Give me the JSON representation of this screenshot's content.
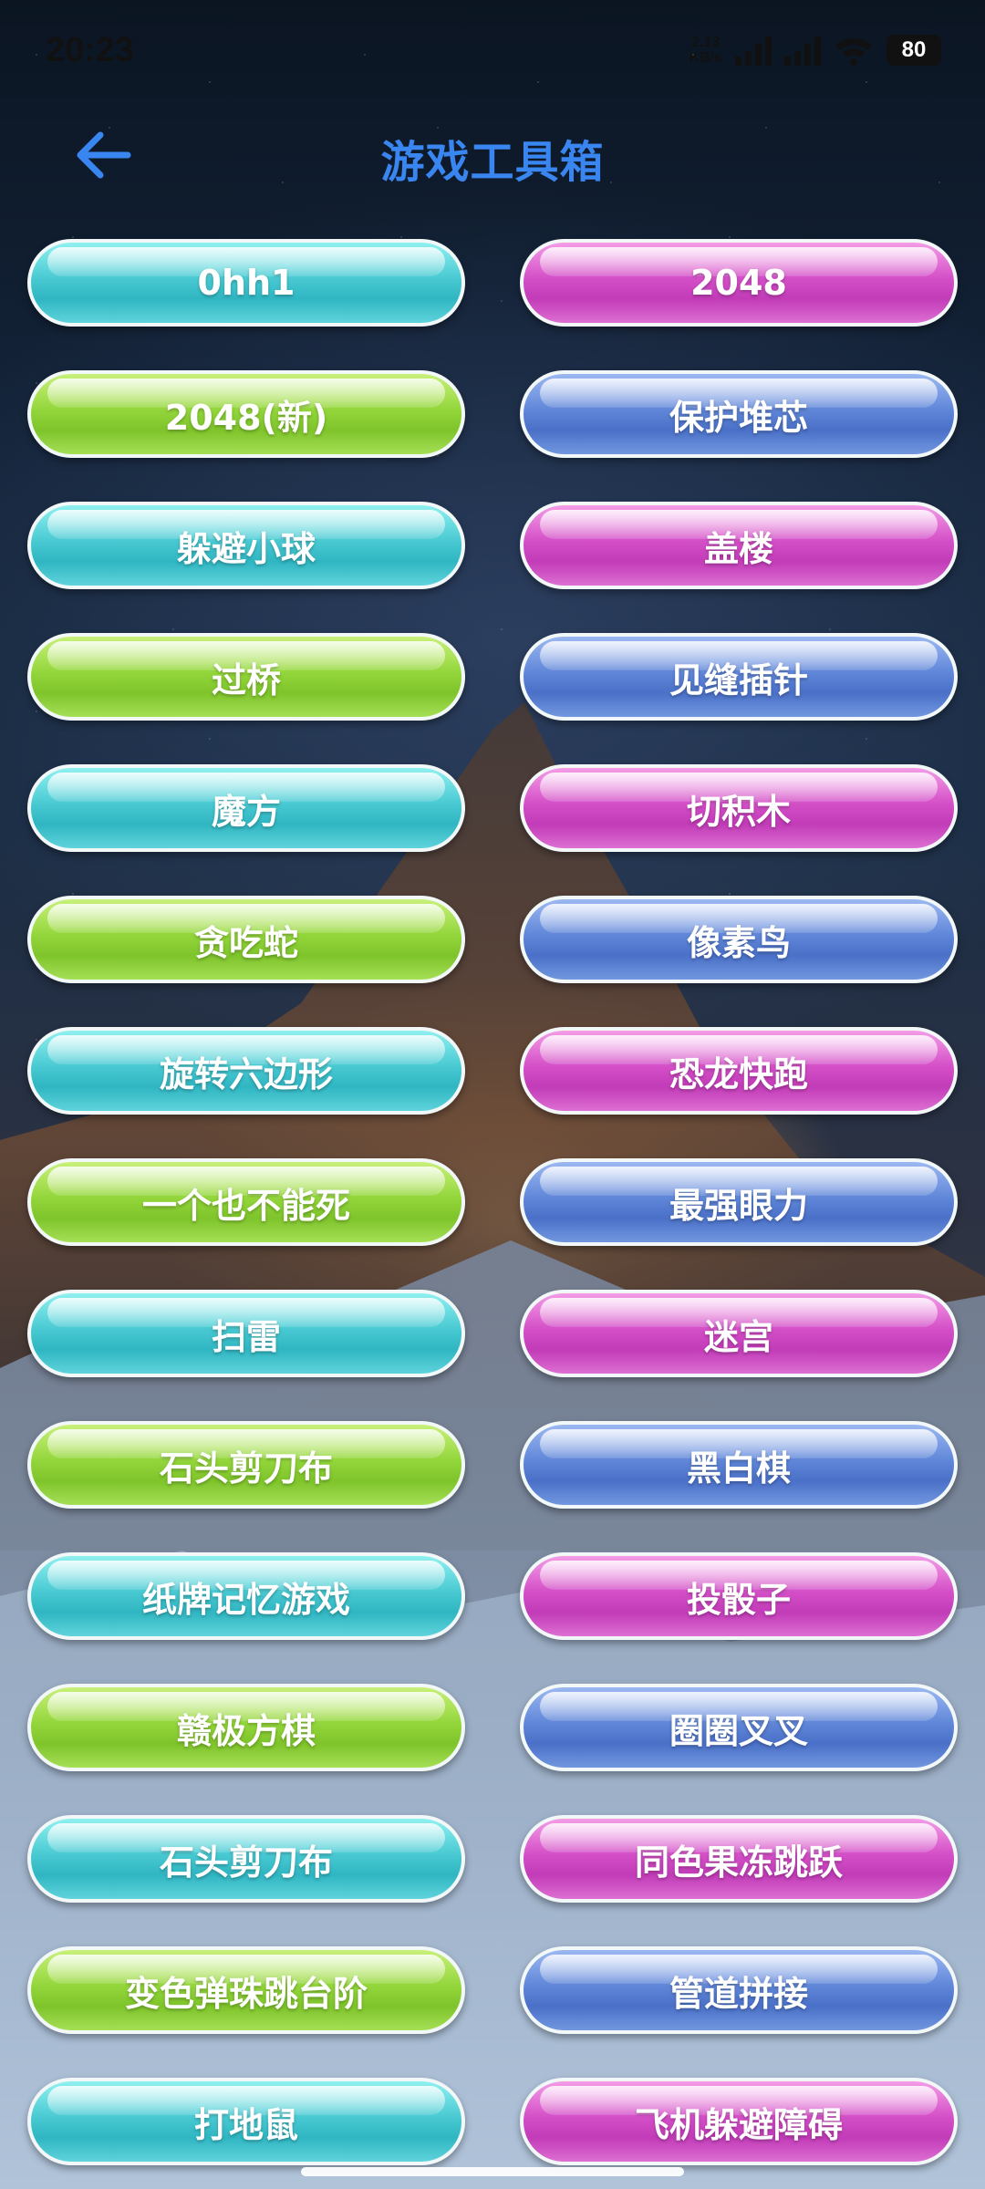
{
  "status": {
    "time": "20:23",
    "net_speed_value": "2.13",
    "net_speed_unit": "KB/s",
    "battery": "80"
  },
  "header": {
    "title": "游戏工具箱",
    "back_icon": "arrow-left-icon"
  },
  "colors": {
    "title": "#3a86f0",
    "cyan": "#48c9d2",
    "green": "#93d63b",
    "magenta": "#d34fc7",
    "blue": "#5f86d8"
  },
  "games": [
    {
      "label": "0hh1",
      "color": "cyan"
    },
    {
      "label": "2048",
      "color": "magenta"
    },
    {
      "label": "2048(新)",
      "color": "green"
    },
    {
      "label": "保护堆芯",
      "color": "blue"
    },
    {
      "label": "躲避小球",
      "color": "cyan"
    },
    {
      "label": "盖楼",
      "color": "magenta"
    },
    {
      "label": "过桥",
      "color": "green"
    },
    {
      "label": "见缝插针",
      "color": "blue"
    },
    {
      "label": "魔方",
      "color": "cyan"
    },
    {
      "label": "切积木",
      "color": "magenta"
    },
    {
      "label": "贪吃蛇",
      "color": "green"
    },
    {
      "label": "像素鸟",
      "color": "blue"
    },
    {
      "label": "旋转六边形",
      "color": "cyan"
    },
    {
      "label": "恐龙快跑",
      "color": "magenta"
    },
    {
      "label": "一个也不能死",
      "color": "green"
    },
    {
      "label": "最强眼力",
      "color": "blue"
    },
    {
      "label": "扫雷",
      "color": "cyan"
    },
    {
      "label": "迷宫",
      "color": "magenta"
    },
    {
      "label": "石头剪刀布",
      "color": "green"
    },
    {
      "label": "黑白棋",
      "color": "blue"
    },
    {
      "label": "纸牌记忆游戏",
      "color": "cyan"
    },
    {
      "label": "投骰子",
      "color": "magenta"
    },
    {
      "label": "赣极方棋",
      "color": "green"
    },
    {
      "label": "圈圈叉叉",
      "color": "blue"
    },
    {
      "label": "石头剪刀布",
      "color": "cyan"
    },
    {
      "label": "同色果冻跳跃",
      "color": "magenta"
    },
    {
      "label": "变色弹珠跳台阶",
      "color": "green"
    },
    {
      "label": "管道拼接",
      "color": "blue"
    },
    {
      "label": "打地鼠",
      "color": "cyan"
    },
    {
      "label": "飞机躲避障碍",
      "color": "magenta"
    }
  ]
}
